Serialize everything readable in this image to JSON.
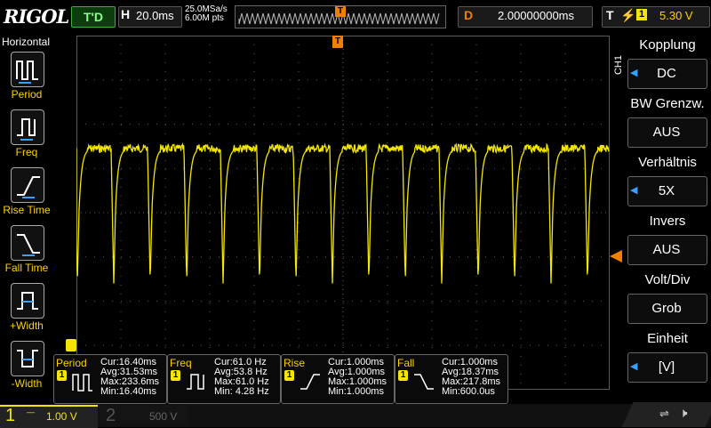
{
  "header": {
    "logo": "RIGOL",
    "run_status": "T'D",
    "timebase_label": "H",
    "timebase_value": "20.0ms",
    "sample_rate": "25.0MSa/s",
    "memory_depth": "6.00M pts",
    "trigger_marker": "T",
    "delay_label": "D",
    "delay_value": "2.00000000ms",
    "trigger_label": "T",
    "trigger_channel": "1",
    "trigger_level": "5.30 V"
  },
  "left_panel": {
    "title": "Horizontal",
    "items": [
      {
        "label": "Period",
        "icon": "period-icon"
      },
      {
        "label": "Freq",
        "icon": "freq-icon"
      },
      {
        "label": "Rise Time",
        "icon": "rise-time-icon"
      },
      {
        "label": "Fall Time",
        "icon": "fall-time-icon"
      },
      {
        "label": "+Width",
        "icon": "plus-width-icon"
      },
      {
        "label": "-Width",
        "icon": "minus-width-icon"
      }
    ]
  },
  "right_panel": {
    "channel_tag": "CH1",
    "items": [
      {
        "title": "Kopplung",
        "value": "DC"
      },
      {
        "title": "BW Grenzw.",
        "value": "AUS"
      },
      {
        "title": "Verhältnis",
        "value": "5X"
      },
      {
        "title": "Invers",
        "value": "AUS"
      },
      {
        "title": "Volt/Div",
        "value": "Grob"
      },
      {
        "title": "Einheit",
        "value": "[V]"
      }
    ]
  },
  "measurements": [
    {
      "name": "Period",
      "channel": "1",
      "cur": "Cur:16.40ms",
      "avg": "Avg:31.53ms",
      "max": "Max:233.6ms",
      "min": "Min:16.40ms"
    },
    {
      "name": "Freq",
      "channel": "1",
      "cur": "Cur:61.0 Hz",
      "avg": "Avg:53.8 Hz",
      "max": "Max:61.0 Hz",
      "min": "Min: 4.28 Hz"
    },
    {
      "name": "Rise",
      "channel": "1",
      "cur": "Cur:1.000ms",
      "avg": "Avg:1.000ms",
      "max": "Max:1.000ms",
      "min": "Min:1.000ms"
    },
    {
      "name": "Fall",
      "channel": "1",
      "cur": "Cur:1.000ms",
      "avg": "Avg:18.37ms",
      "max": "Max:217.8ms",
      "min": "Min:600.0us"
    }
  ],
  "footer": {
    "ch1_number": "1",
    "ch1_scale": "1.00 V",
    "ch2_number": "2",
    "ch2_scale": "500 V"
  },
  "colors": {
    "ch1": "#f5e600",
    "trigger_orange": "#f08000",
    "grid": "#5a5a5a",
    "accent_blue": "#3aa0ff"
  },
  "waveform": {
    "pulse_period_divs": 0.82,
    "high_level_divs": 1.45,
    "low_level_divs": -1.6
  }
}
